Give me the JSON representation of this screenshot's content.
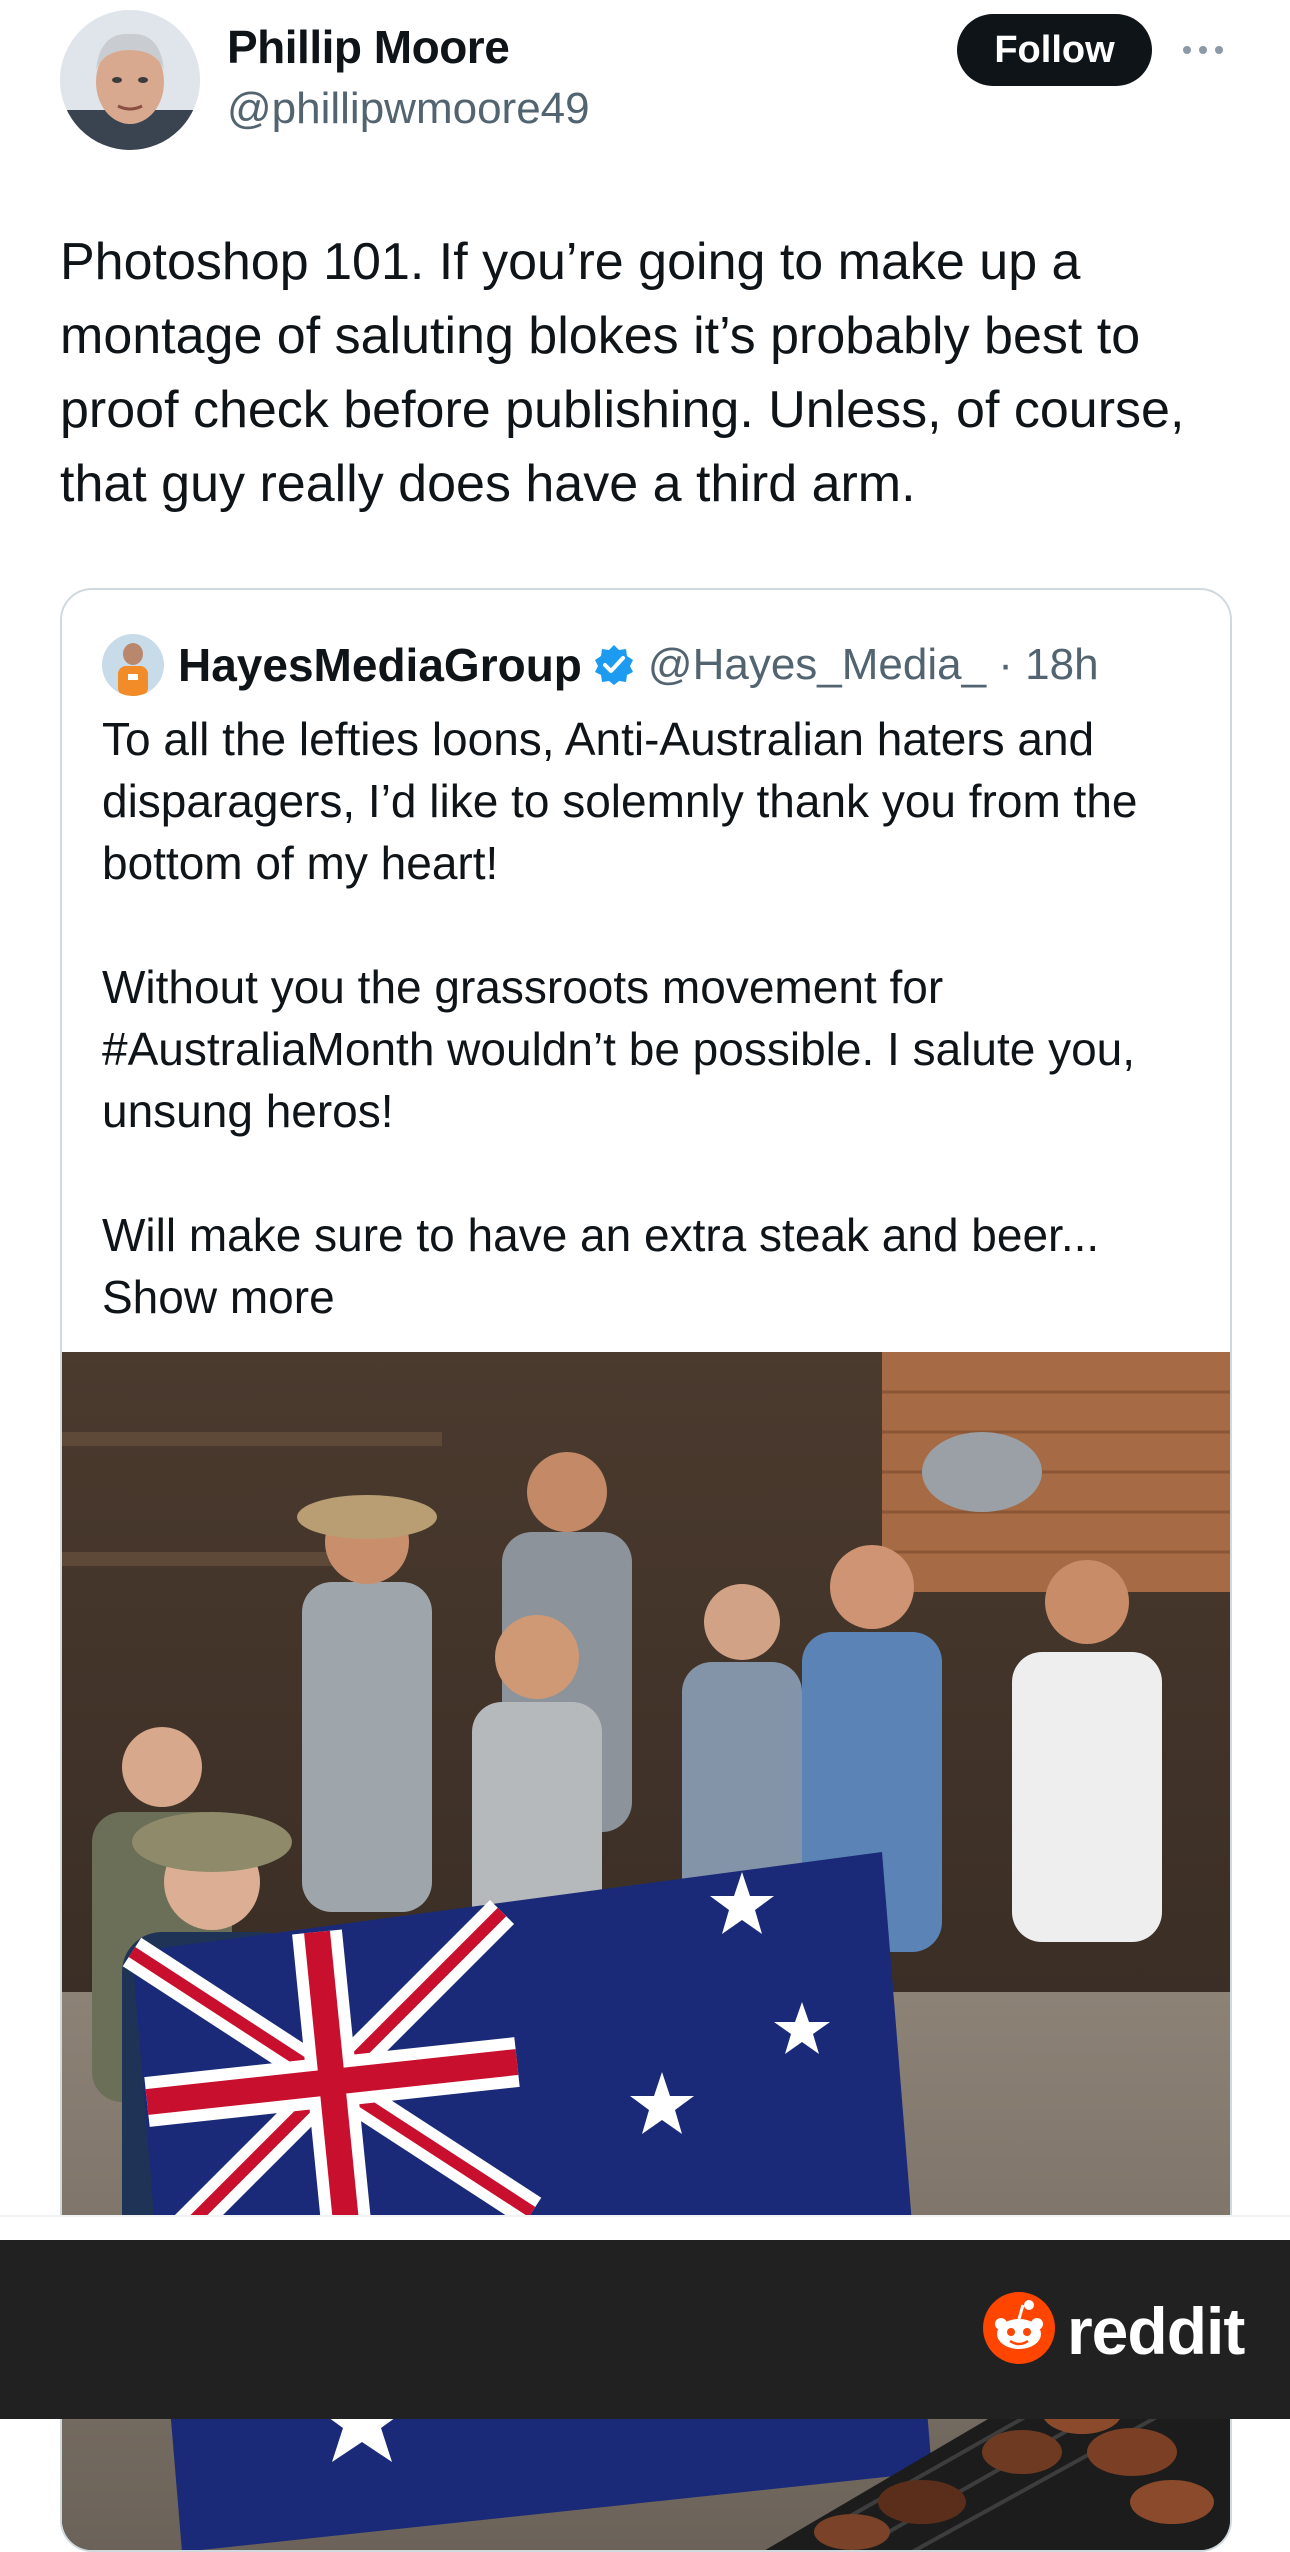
{
  "author": {
    "name": "Phillip Moore",
    "handle": "@phillipwmoore49",
    "follow_label": "Follow",
    "more_icon": "more-horizontal-icon"
  },
  "tweet": {
    "text": "Photoshop 101. If you’re going to make up a montage of saluting blokes it’s probably best to proof check before publishing. Unless, of course, that guy really does have a third arm."
  },
  "quote": {
    "name": "HayesMediaGroup",
    "handle_time": "@Hayes_Media_ · 18h",
    "paragraph1": "To all the lefties loons, Anti-Australian haters and disparagers, I’d like to solemnly thank you from the bottom of my heart!",
    "paragraph2": "Without you the grassroots movement for #AustraliaMonth wouldn’t be possible. I salute you, unsung heros!",
    "paragraph3": "Will make sure to have an extra steak and beer...",
    "show_more": "Show more",
    "verified_icon": "verified-badge-icon"
  },
  "footer": {
    "brand": "reddit",
    "brand_color": "#ff4500",
    "bar_color": "#212121"
  }
}
